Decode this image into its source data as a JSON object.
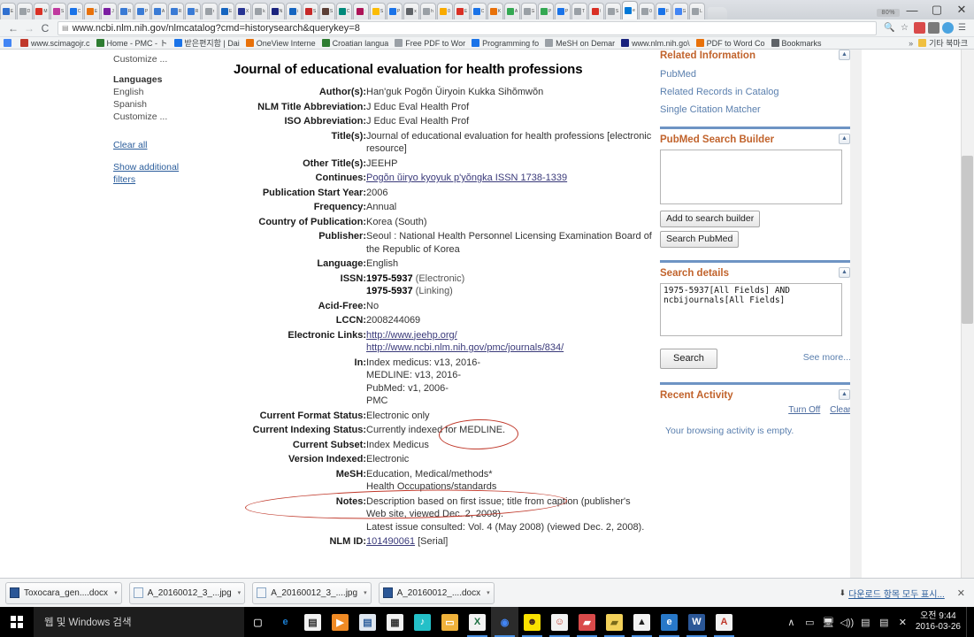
{
  "browser": {
    "window_controls": {
      "minimize": "—",
      "maximize": "▢",
      "close": "✕"
    },
    "tab_overflow_badge": "80%",
    "nav": {
      "back": "←",
      "forward": "→",
      "reload": "C"
    },
    "omnibox": {
      "page_icon": "page-icon",
      "url": "www.ncbi.nlm.nih.gov/nlmcatalog?cmd=historysearch&querykey=8",
      "zoom_icon": "zoom-icon",
      "star_icon": "star-icon"
    },
    "toolbar_extensions": [
      "pdf-extension-icon",
      "text-extension-icon",
      "diamond-extension-icon",
      "chrome-menu-icon"
    ],
    "tabs": [
      {
        "title": "E",
        "color": "#2f6fd0"
      },
      {
        "title": "D",
        "color": "#9aa0a6"
      },
      {
        "title": "M",
        "color": "#d93025"
      },
      {
        "title": "S",
        "color": "#c0399f"
      },
      {
        "title": "C",
        "color": "#1a73e8"
      },
      {
        "title": "E",
        "color": "#e8710a"
      },
      {
        "title": "J",
        "color": "#7b1fa2"
      },
      {
        "title": "R",
        "color": "#3a7bd5"
      },
      {
        "title": "P",
        "color": "#3a7bd5"
      },
      {
        "title": "A",
        "color": "#3a7bd5"
      },
      {
        "title": "R",
        "color": "#3a7bd5"
      },
      {
        "title": "R",
        "color": "#3a7bd5"
      },
      {
        "title": "r",
        "color": "#9aa0a6"
      },
      {
        "title": "E",
        "color": "#1565c0"
      },
      {
        "title": "X",
        "color": "#283593"
      },
      {
        "title": "k",
        "color": "#9aa0a6"
      },
      {
        "title": "N",
        "color": "#1a237e"
      },
      {
        "title": "i",
        "color": "#1565c0"
      },
      {
        "title": "S",
        "color": "#c62828"
      },
      {
        "title": "S",
        "color": "#5d4037"
      },
      {
        "title": "C",
        "color": "#00897b"
      },
      {
        "title": ":",
        "color": "#ad1457"
      },
      {
        "title": "S",
        "color": "#fbbc04"
      },
      {
        "title": "P",
        "color": "#1a73e8"
      },
      {
        "title": "x",
        "color": "#5f6368"
      },
      {
        "title": "h",
        "color": "#9aa0a6"
      },
      {
        "title": "0",
        "color": "#f9ab00"
      },
      {
        "title": "E",
        "color": "#d93025"
      },
      {
        "title": "C",
        "color": "#1a73e8"
      },
      {
        "title": "K",
        "color": "#e8710a"
      },
      {
        "title": "A",
        "color": "#34a853"
      },
      {
        "title": "G",
        "color": "#9aa0a6"
      },
      {
        "title": "P",
        "color": "#34a853"
      },
      {
        "title": "P",
        "color": "#1a73e8"
      },
      {
        "title": "T",
        "color": "#9aa0a6"
      },
      {
        "title": "/",
        "color": "#d93025"
      },
      {
        "title": "S",
        "color": "#9aa0a6"
      },
      {
        "title": "e",
        "color": "#0078d7"
      },
      {
        "title": "0",
        "color": "#9aa0a6"
      },
      {
        "title": "F",
        "color": "#1a73e8"
      },
      {
        "title": "G",
        "color": "#4285f4"
      },
      {
        "title": "L",
        "color": "#9aa0a6"
      }
    ],
    "bookmarks": [
      {
        "label": "앱",
        "icon_color": "#4285f4"
      },
      {
        "label": "www.scimagojr.c",
        "icon_color": "#c0392b"
      },
      {
        "label": "Home - PMC - ト",
        "icon_color": "#2e7d32"
      },
      {
        "label": "받은편지함 | Dai",
        "icon_color": "#1a73e8"
      },
      {
        "label": "OneView Interne",
        "icon_color": "#e8710a"
      },
      {
        "label": "Croatian langua",
        "icon_color": "#2e7d32"
      },
      {
        "label": "Free PDF to Wor",
        "icon_color": "#9aa0a6"
      },
      {
        "label": "Programming fo",
        "icon_color": "#1a73e8"
      },
      {
        "label": "MeSH on Demar",
        "icon_color": "#9aa0a6"
      },
      {
        "label": "www.nlm.nih.go\\",
        "icon_color": "#1a237e"
      },
      {
        "label": "PDF to Word Co",
        "icon_color": "#e8710a"
      },
      {
        "label": "Bookmarks",
        "icon_color": "#5f6368"
      }
    ],
    "bookmarks_overflow": "»",
    "other_bookmarks": "기타 북마크"
  },
  "facets": {
    "customize_top": "Customize ...",
    "languages_heading": "Languages",
    "language_items": [
      "English",
      "Spanish",
      "Customize ..."
    ],
    "clear_all": "Clear all",
    "show_additional_filters": "Show additional filters"
  },
  "record": {
    "title": "Journal of educational evaluation for health professions",
    "fields": [
      {
        "label": "Author(s):",
        "lines": [
          "Han'guk Pogŏn Ŭiryoin Kukka Sihŏmwŏn"
        ]
      },
      {
        "label": "NLM Title Abbreviation:",
        "lines": [
          "J Educ Eval Health Prof"
        ]
      },
      {
        "label": "ISO Abbreviation:",
        "lines": [
          "J Educ Eval Health Prof"
        ]
      },
      {
        "label": "Title(s):",
        "lines": [
          "Journal of educational evaluation for health professions [electronic resource]"
        ]
      },
      {
        "label": "Other Title(s):",
        "lines": [
          "JEEHP"
        ]
      },
      {
        "label": "Continues:",
        "lines": [
          "Pogŏn ŭiryo kyoyuk p'yŏngka ISSN 1738-1339"
        ],
        "link": true
      },
      {
        "label": "Publication Start Year:",
        "lines": [
          "2006"
        ]
      },
      {
        "label": "Frequency:",
        "lines": [
          "Annual"
        ]
      },
      {
        "label": "Country of Publication:",
        "lines": [
          "Korea (South)"
        ]
      },
      {
        "label": "Publisher:",
        "lines": [
          "Seoul : National Health Personnel Licensing Examination Board of the Republic of Korea"
        ]
      },
      {
        "label": "Language:",
        "lines": [
          "English"
        ]
      },
      {
        "label": "ISSN:",
        "lines": [
          "1975-5937 (Electronic)",
          "1975-5937 (Linking)"
        ],
        "bold_prefix": true
      },
      {
        "label": "Acid-Free:",
        "lines": [
          "No"
        ]
      },
      {
        "label": "LCCN:",
        "lines": [
          "2008244069"
        ]
      },
      {
        "label": "Electronic Links:",
        "lines": [
          "http://www.jeehp.org/",
          "http://www.ncbi.nlm.nih.gov/pmc/journals/834/"
        ],
        "link": true
      },
      {
        "label": "In:",
        "lines": [
          "Index medicus: v13, 2016-",
          "MEDLINE: v13, 2016-",
          "PubMed: v1, 2006-",
          "PMC"
        ]
      },
      {
        "label": "Current Format Status:",
        "lines": [
          "Electronic only"
        ]
      },
      {
        "label": "Current Indexing Status:",
        "lines": [
          "Currently indexed for MEDLINE."
        ]
      },
      {
        "label": "Current Subset:",
        "lines": [
          "Index Medicus"
        ]
      },
      {
        "label": "Version Indexed:",
        "lines": [
          "Electronic"
        ]
      },
      {
        "label": "MeSH:",
        "lines": [
          "Education, Medical/methods*",
          "Health Occupations/standards"
        ]
      },
      {
        "label": "Notes:",
        "lines": [
          "Description based on first issue; title from caption (publisher's Web site, viewed Dec. 2, 2008).",
          "Latest issue consulted: Vol. 4 (May 2008) (viewed Dec. 2, 2008)."
        ]
      },
      {
        "label": "NLM ID:",
        "lines": [
          "101490061 [Serial]"
        ],
        "link_first": true
      }
    ],
    "annotation_color": "#c0392b"
  },
  "right_panel": {
    "related_information": {
      "title": "Related Information",
      "collapse_icon": "collapse-icon",
      "links": [
        "PubMed",
        "Related Records in Catalog",
        "Single Citation Matcher"
      ]
    },
    "pubmed_search_builder": {
      "title": "PubMed Search Builder",
      "collapse_icon": "collapse-icon",
      "textarea_value": "",
      "add_button": "Add to search builder",
      "search_button": "Search PubMed"
    },
    "search_details": {
      "title": "Search details",
      "collapse_icon": "collapse-icon",
      "query": "1975-5937[All Fields] AND ncbijournals[All Fields]",
      "search_button": "Search",
      "see_more": "See more..."
    },
    "recent_activity": {
      "title": "Recent Activity",
      "collapse_icon": "collapse-icon",
      "turn_off": "Turn Off",
      "clear": "Clear",
      "empty_message": "Your browsing activity is empty."
    }
  },
  "downloads_shelf": {
    "items": [
      {
        "name": "Toxocara_gen....docx",
        "type": "docx"
      },
      {
        "name": "A_20160012_3_...jpg",
        "type": "jpg"
      },
      {
        "name": "A_20160012_3_....jpg",
        "type": "jpg"
      },
      {
        "name": "A_20160012_....docx",
        "type": "docx"
      }
    ],
    "show_all": "다운로드 항목 모두 표시...",
    "close": "✕"
  },
  "taskbar": {
    "start_icon": "windows-start-icon",
    "search_placeholder": "웹 및 Windows 검색",
    "icons": [
      {
        "name": "task-view-icon",
        "glyph": "▢",
        "bg": "transparent",
        "fg": "#c8c8c8",
        "running": false
      },
      {
        "name": "edge-icon",
        "glyph": "e",
        "bg": "transparent",
        "fg": "#1b7fd4",
        "running": false
      },
      {
        "name": "store-icon",
        "glyph": "▤",
        "bg": "#f2f2f2",
        "fg": "#2b2b2b",
        "running": false
      },
      {
        "name": "media-player-icon",
        "glyph": "▶",
        "bg": "#f08a24",
        "fg": "#ffffff",
        "running": false
      },
      {
        "name": "contacts-icon",
        "glyph": "▤",
        "bg": "#dfe7f0",
        "fg": "#2b5d9b",
        "running": false
      },
      {
        "name": "calculator-icon",
        "glyph": "▦",
        "bg": "#f2f2f2",
        "fg": "#333333",
        "running": false
      },
      {
        "name": "music-icon",
        "glyph": "♪",
        "bg": "#24c0c8",
        "fg": "#ffffff",
        "running": false
      },
      {
        "name": "file-explorer-icon",
        "glyph": "▭",
        "bg": "#f0b23a",
        "fg": "#ffffff",
        "running": false
      },
      {
        "name": "excel-icon",
        "glyph": "X",
        "bg": "#f2f2f2",
        "fg": "#1d6f42",
        "running": true
      },
      {
        "name": "chrome-icon",
        "glyph": "◉",
        "bg": "transparent",
        "fg": "#4285f4",
        "running": true,
        "active": true
      },
      {
        "name": "kakaotalk-icon",
        "glyph": "☻",
        "bg": "#fae100",
        "fg": "#3c1e1e",
        "running": true
      },
      {
        "name": "messenger-icon",
        "glyph": "☺",
        "bg": "#f2f2f2",
        "fg": "#c0392b",
        "running": true
      },
      {
        "name": "endnote-icon",
        "glyph": "▰",
        "bg": "#d94a4a",
        "fg": "#ffffff",
        "running": true
      },
      {
        "name": "notes-icon",
        "glyph": "▰",
        "bg": "#f2d15a",
        "fg": "#7a6a1a",
        "running": true
      },
      {
        "name": "photo-viewer-icon",
        "glyph": "▲",
        "bg": "#f2f2f2",
        "fg": "#222222",
        "running": true
      },
      {
        "name": "edge-pinned-icon",
        "glyph": "e",
        "bg": "#2878c8",
        "fg": "#ffffff",
        "running": true
      },
      {
        "name": "word-icon",
        "glyph": "W",
        "bg": "#2b5797",
        "fg": "#ffffff",
        "running": true
      },
      {
        "name": "acrobat-icon",
        "glyph": "A",
        "bg": "#f2f2f2",
        "fg": "#c0392b",
        "running": true
      }
    ],
    "tray": [
      {
        "name": "tray-chevron-icon",
        "glyph": "∧"
      },
      {
        "name": "tray-removable-drive-icon",
        "glyph": "▭"
      },
      {
        "name": "tray-network-icon",
        "glyph": "🖥"
      },
      {
        "name": "tray-volume-icon",
        "glyph": "◁))"
      },
      {
        "name": "tray-keyboard-icon",
        "glyph": "▤"
      },
      {
        "name": "tray-action-center-icon",
        "glyph": "▤"
      },
      {
        "name": "tray-notification-badge",
        "glyph": "✕"
      }
    ],
    "clock": {
      "time": "오전 9:44",
      "date": "2016-03-26"
    }
  }
}
